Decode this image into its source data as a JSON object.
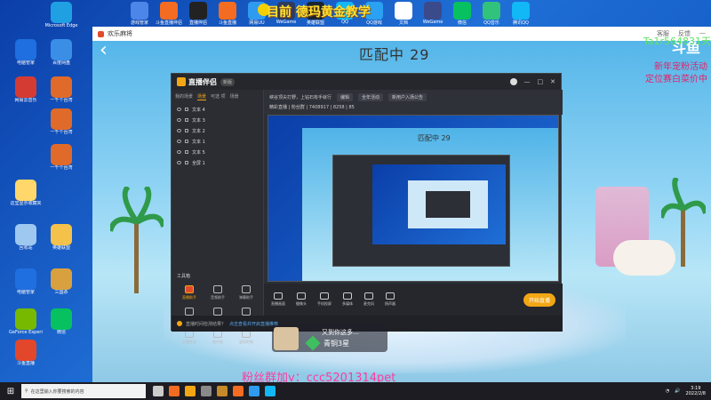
{
  "overlay": {
    "title": "目前 德玛黄金教学",
    "fan_group": "粉丝群加v：ccc5201314pet"
  },
  "desktop": {
    "top_icons": [
      {
        "label": "游戏管家",
        "color": "#4c86e8"
      },
      {
        "label": "斗鱼直播伴侣",
        "color": "#f36c21"
      },
      {
        "label": "直播伴侣",
        "color": "#222"
      },
      {
        "label": "斗鱼直播",
        "color": "#f36c21"
      },
      {
        "label": "网易UU",
        "color": "#2e9bf0"
      },
      {
        "label": "WeGame",
        "color": "#2e3a60"
      },
      {
        "label": "英雄联盟",
        "color": "#1a2430"
      },
      {
        "label": "QQ",
        "color": "#12b7f5"
      },
      {
        "label": "QQ游戏",
        "color": "#2aa1f2"
      },
      {
        "label": "文档",
        "color": "#ffffff"
      },
      {
        "label": "WeGame",
        "color": "#3b4a8a"
      },
      {
        "label": "微信",
        "color": "#07c160"
      },
      {
        "label": "QQ音乐",
        "color": "#31c27c"
      },
      {
        "label": "腾讯QQ",
        "color": "#12b7f5"
      }
    ],
    "left_icons": [
      {
        "label": "Microsoft Edge",
        "color": "#1fa0e3"
      },
      {
        "label": "电脑管家",
        "color": "#1f6fe0"
      },
      {
        "label": "百度网盘",
        "color": "#3a8ee6"
      },
      {
        "label": "网易云音乐",
        "color": "#d43c33"
      },
      {
        "label": "一千个台湾",
        "color": "#e06a2a"
      },
      {
        "label": "一千个台湾",
        "color": "#e06a2a"
      },
      {
        "label": "一千个台湾",
        "color": "#e06a2a"
      },
      {
        "label": "这里显示收藏夹",
        "color": "#ffd76a"
      },
      {
        "label": "回收站",
        "color": "#9ec8f0"
      },
      {
        "label": "英雄联盟",
        "color": "#f4c24a"
      },
      {
        "label": "电脑管家",
        "color": "#1f6fe0"
      },
      {
        "label": "三国杀",
        "color": "#d9a040"
      },
      {
        "label": "GeForce Experience",
        "color": "#76b900"
      },
      {
        "label": "微信",
        "color": "#07c160"
      },
      {
        "label": "斗鱼直播",
        "color": "#e2472b"
      }
    ]
  },
  "main_window": {
    "title": "欢乐麻将",
    "header_right": [
      "客服",
      "反馈",
      "最小化"
    ],
    "matching_text": "匹配中 29",
    "logo_text": "斗鱼",
    "right_id": "Ta1r564831天",
    "promo1": "新年宠粉活动",
    "promo2": "定位赛白菜价中"
  },
  "obs": {
    "app_name": "直播伴侣",
    "version": "新版",
    "tabs": [
      "我的场景",
      "场景",
      "可选 项",
      "场景"
    ],
    "active_tab": "场景",
    "sources": [
      "文本 4",
      "文本 3",
      "文本 2",
      "文本 1",
      "文本 5",
      "全屏 1"
    ],
    "toolbox_title": "工具箱",
    "tools": [
      {
        "label": "直播助手",
        "hl": true
      },
      {
        "label": "音频助手",
        "hl": false
      },
      {
        "label": "弹幕助手",
        "hl": false
      },
      {
        "label": "视频设置",
        "hl": false
      },
      {
        "label": "多人连麦",
        "hl": false
      },
      {
        "label": "弹幕助手",
        "hl": false
      },
      {
        "label": "主播任务",
        "hl": false
      },
      {
        "label": "画中画",
        "hl": false
      },
      {
        "label": "虚拟形象",
        "hl": false
      }
    ],
    "topbar_line1": "峡谷顶尖打野，上钻石有手就行",
    "topbar_edit": "编辑",
    "topbar_category": "全年活动",
    "topbar_new": "新用户入场公告",
    "topbar_line2": "精彩直播 | 粉丝群 | 7408917 | 8258 | 85",
    "preview_text": "匹配中 29",
    "bottom_buttons": [
      "直播画面",
      "摄像头",
      "手机投屏",
      "多媒体",
      "麦克风",
      "扬声器"
    ],
    "start_live": "开始直播",
    "status_text": "直播时间检测结果？",
    "status_link": "点击查看并开启直播推荐"
  },
  "player_card": {
    "name": "又到你这多…",
    "rank": "青铜3星"
  },
  "taskbar": {
    "search_placeholder": "在这里输入你要搜索的内容",
    "apps": [
      {
        "name": "app",
        "color": "#ccc"
      },
      {
        "name": "app",
        "color": "#f36c21"
      },
      {
        "name": "app",
        "color": "#f3a614"
      },
      {
        "name": "app",
        "color": "#8a8a8a"
      },
      {
        "name": "app",
        "color": "#c58a2a"
      },
      {
        "name": "app",
        "color": "#f36c21"
      },
      {
        "name": "app",
        "color": "#2e9bf0"
      },
      {
        "name": "app",
        "color": "#12b7f5"
      }
    ],
    "time": "3:19",
    "date": "2022/2/8"
  }
}
